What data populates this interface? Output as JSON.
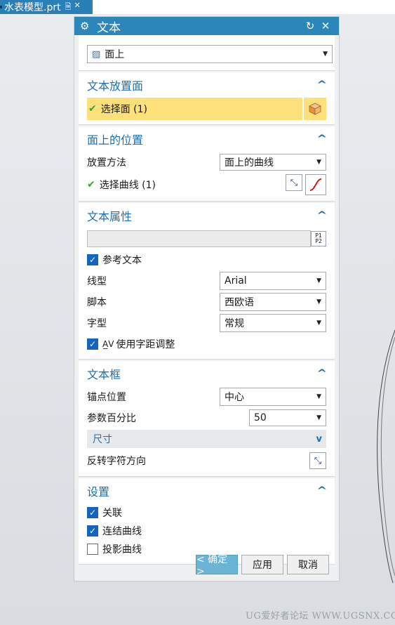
{
  "file_tab": {
    "name": "水表模型.prt"
  },
  "dialog": {
    "title": "文本",
    "type_select": "面上",
    "sections": {
      "placement_face": {
        "title": "文本放置面",
        "select_label": "选择面 (1)"
      },
      "position_on_face": {
        "title": "面上的位置",
        "method_label": "放置方法",
        "method_value": "面上的曲线",
        "select_curve_label": "选择曲线 (1)"
      },
      "text_properties": {
        "title": "文本属性",
        "text_value": "",
        "ref_text_label": "参考文本",
        "line_label": "线型",
        "line_value": "Arial",
        "script_label": "脚本",
        "script_value": "西欧语",
        "style_label": "字型",
        "style_value": "常规",
        "kerning_label": "使用字距调整"
      },
      "text_box": {
        "title": "文本框",
        "anchor_label": "锚点位置",
        "anchor_value": "中心",
        "param_label": "参数百分比",
        "param_value": "50",
        "size_label": "尺寸",
        "reverse_label": "反转字符方向"
      },
      "settings": {
        "title": "设置",
        "associative_label": "关联",
        "join_curves_label": "连结曲线",
        "project_curves_label": "投影曲线"
      }
    },
    "buttons": {
      "ok": "< 确定 >",
      "apply": "应用",
      "cancel": "取消"
    }
  },
  "watermark": "UG爱好者论坛 WWW.UGSNX.COM",
  "colors": {
    "titlebar": "#2d86b9",
    "accent": "#1e6fb0",
    "highlight": "#fde07a"
  }
}
